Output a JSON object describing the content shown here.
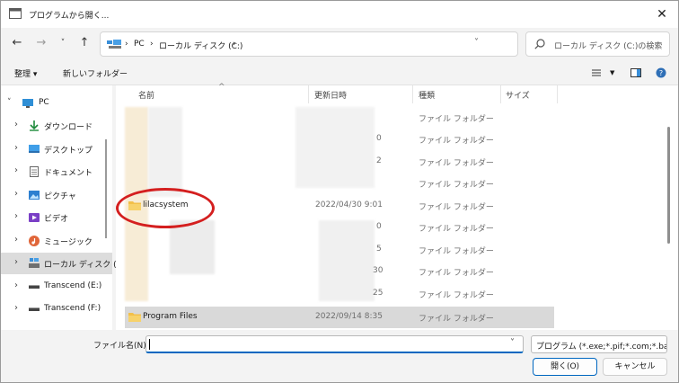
{
  "window": {
    "title": "プログラムから開く..."
  },
  "address": {
    "crumbs": [
      "PC",
      "ローカル ディスク (C:)"
    ],
    "separator": "›"
  },
  "search": {
    "placeholder": "ローカル ディスク (C:)の検索"
  },
  "commandbar": {
    "organize": "整理 ▾",
    "new_folder": "新しいフォルダー"
  },
  "navpane": {
    "items": [
      {
        "label": "PC",
        "icon": "monitor-icon"
      },
      {
        "label": "ダウンロード",
        "icon": "download-icon"
      },
      {
        "label": "デスクトップ",
        "icon": "desktop-icon"
      },
      {
        "label": "ドキュメント",
        "icon": "document-icon"
      },
      {
        "label": "ピクチャ",
        "icon": "picture-icon"
      },
      {
        "label": "ビデオ",
        "icon": "video-icon"
      },
      {
        "label": "ミュージック",
        "icon": "music-icon"
      },
      {
        "label": "ローカル ディスク (",
        "icon": "drive-icon"
      },
      {
        "label": "Transcend (E:)",
        "icon": "usb-drive-icon"
      },
      {
        "label": "Transcend (F:)",
        "icon": "usb-drive-icon"
      }
    ]
  },
  "columns": {
    "name": "名前",
    "date": "更新日時",
    "type": "種類",
    "size": "サイズ"
  },
  "rows": [
    {
      "name": "",
      "date": "",
      "date_tail": "",
      "type": "ファイル フォルダー"
    },
    {
      "name": "",
      "date": "",
      "date_tail": "0",
      "type": "ファイル フォルダー"
    },
    {
      "name": "",
      "date": "",
      "date_tail": "2",
      "type": "ファイル フォルダー"
    },
    {
      "name": "",
      "date": "",
      "date_tail": "",
      "type": "ファイル フォルダー"
    },
    {
      "name": "lilacsystem",
      "date": "2022/04/30 9:01",
      "date_tail": "",
      "type": "ファイル フォルダー"
    },
    {
      "name": "",
      "date": "",
      "date_tail": "0",
      "type": "ファイル フォルダー"
    },
    {
      "name": "",
      "date": "",
      "date_tail": "5",
      "type": "ファイル フォルダー"
    },
    {
      "name": "",
      "date": "",
      "date_tail": "30",
      "type": "ファイル フォルダー"
    },
    {
      "name": "",
      "date": "",
      "date_tail": "25",
      "type": "ファイル フォルダー"
    },
    {
      "name": "Program Files",
      "date": "2022/09/14 8:35",
      "date_tail": "",
      "type": "ファイル フォルダー"
    }
  ],
  "bottom": {
    "filename_label": "ファイル名(N):",
    "filename_value": "",
    "filter": "プログラム (*.exe;*.pif;*.com;*.bat",
    "open_button": "開く(O)",
    "cancel_button": "キャンセル"
  },
  "colors": {
    "accent": "#0067c0",
    "highlight_circle": "#d41f1f",
    "folder": "#f2c04a"
  }
}
